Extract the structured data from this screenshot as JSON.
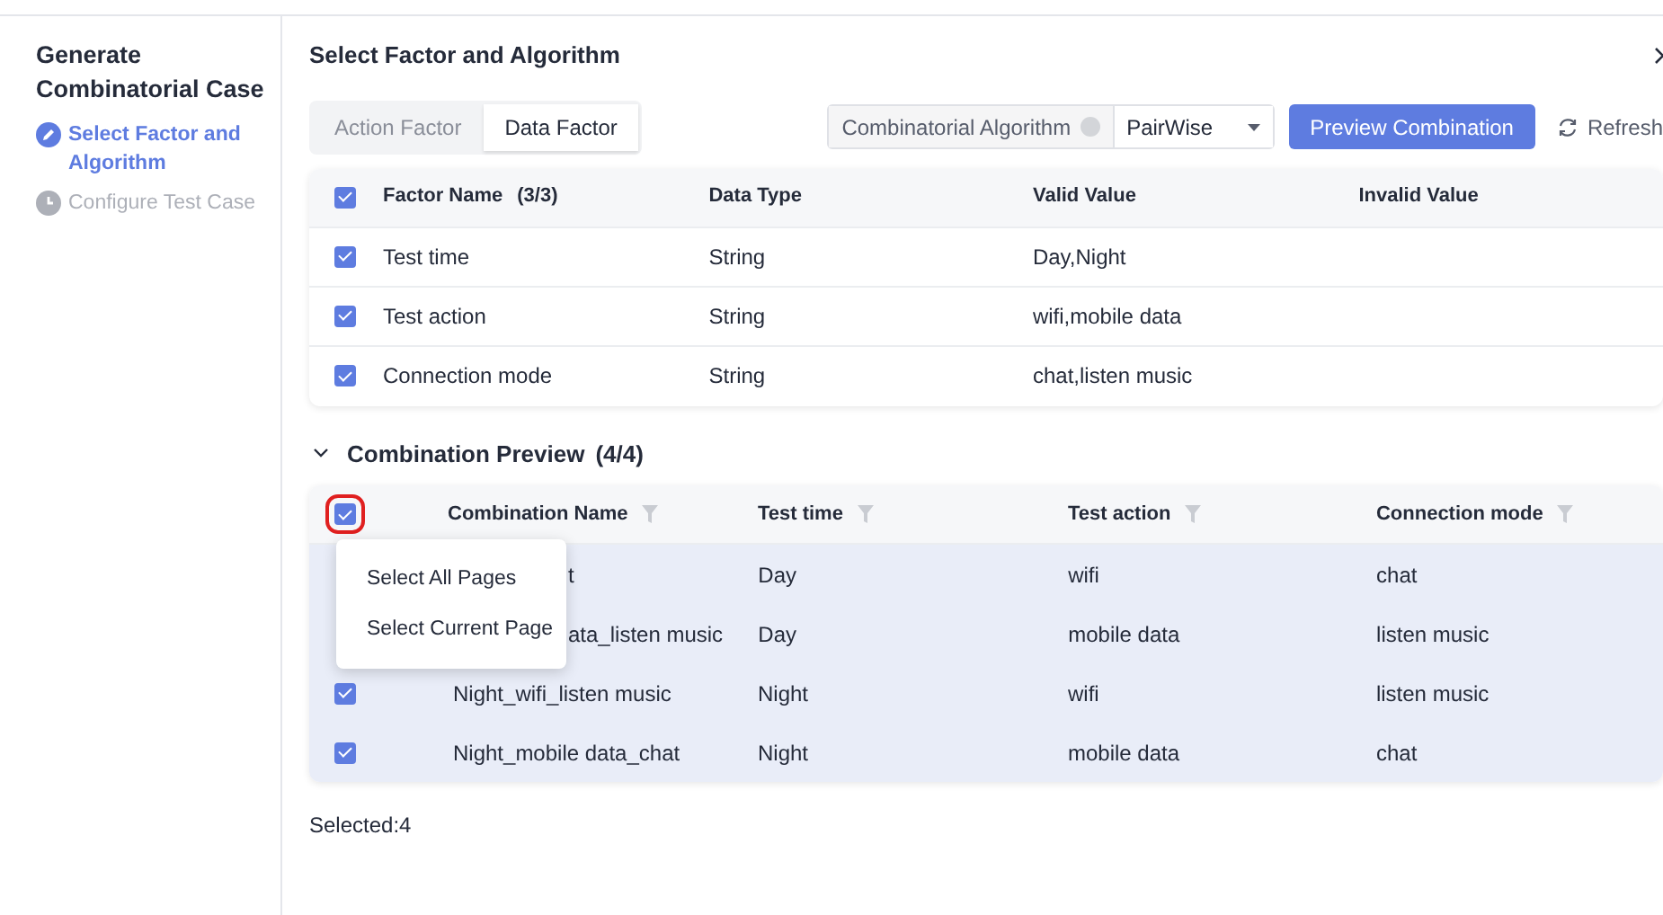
{
  "sidebar": {
    "title": "Generate Combinatorial Case",
    "steps": [
      {
        "label": "Select Factor and Algorithm",
        "active": true
      },
      {
        "label": "Configure Test Case",
        "active": false
      }
    ]
  },
  "main": {
    "title": "Select Factor and Algorithm",
    "tabs": [
      {
        "label": "Action Factor",
        "selected": false
      },
      {
        "label": "Data Factor",
        "selected": true
      }
    ],
    "algorithm": {
      "label": "Combinatorial Algorithm",
      "value": "PairWise"
    },
    "preview_button": "Preview Combination",
    "refresh_button": "Refresh",
    "factor_table": {
      "all_checked": true,
      "columns": [
        "Factor Name",
        "Data Type",
        "Valid Value",
        "Invalid Value"
      ],
      "count": "(3/3)",
      "rows": [
        {
          "checked": true,
          "cells": [
            "Test time",
            "String",
            "Day,Night",
            ""
          ]
        },
        {
          "checked": true,
          "cells": [
            "Test action",
            "String",
            "wifi,mobile data",
            ""
          ]
        },
        {
          "checked": true,
          "cells": [
            "Connection mode",
            "String",
            "chat,listen music",
            ""
          ]
        }
      ]
    },
    "preview": {
      "title": "Combination Preview",
      "count": "(4/4)",
      "expanded": true,
      "all_checked": true,
      "columns": [
        "Combination Name",
        "Test time",
        "Test action",
        "Connection mode"
      ],
      "menu": [
        "Select All Pages",
        "Select Current Page"
      ],
      "rows": [
        {
          "covered_by_menu": true,
          "cells": [
            "t",
            "Day",
            "wifi",
            "chat"
          ]
        },
        {
          "covered_by_menu": true,
          "cells": [
            "ata_listen music",
            "Day",
            "mobile data",
            "listen music"
          ]
        },
        {
          "checked": true,
          "covered_by_menu": false,
          "cells": [
            "Night_wifi_listen music",
            "Night",
            "wifi",
            "listen music"
          ]
        },
        {
          "checked": true,
          "covered_by_menu": false,
          "cells": [
            "Night_mobile data_chat",
            "Night",
            "mobile data",
            "chat"
          ]
        }
      ],
      "selected_text": "Selected:4"
    }
  }
}
